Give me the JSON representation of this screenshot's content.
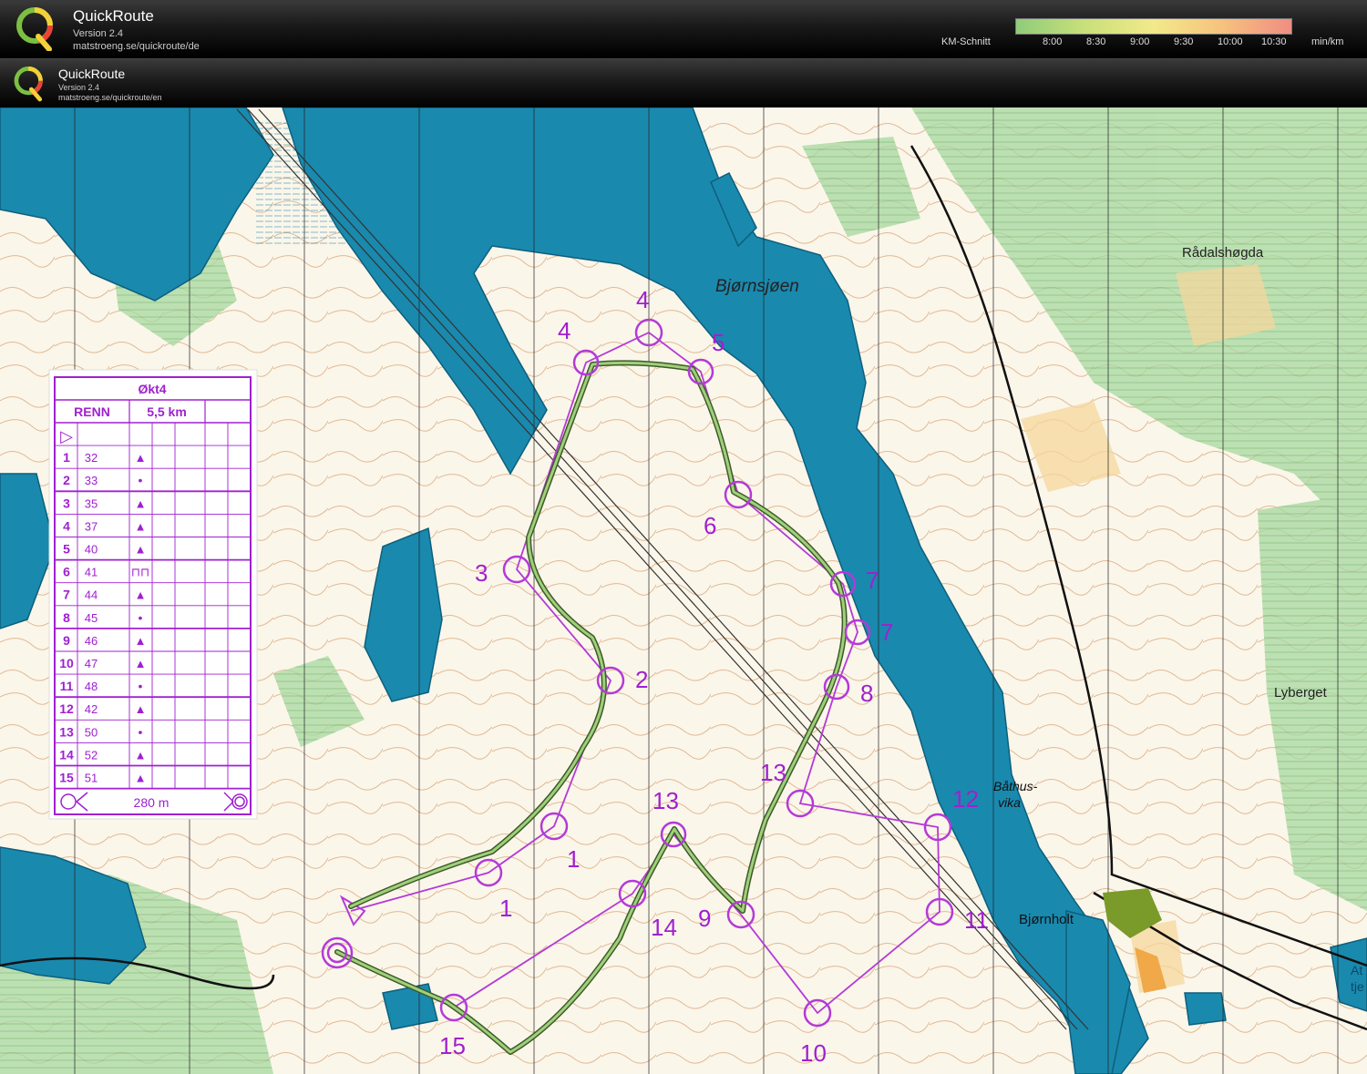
{
  "header_top": {
    "title": "QuickRoute",
    "version": "Version 2.4",
    "url": "matstroeng.se/quickroute/de",
    "pace_label": "KM-Schnitt",
    "pace_ticks": [
      "8:00",
      "8:30",
      "9:00",
      "9:30",
      "10:00",
      "10:30"
    ],
    "pace_unit": "min/km",
    "pace_gradient": [
      "#8fcc7a",
      "#c8e07a",
      "#f3e98a",
      "#f6c27e",
      "#f08d83"
    ]
  },
  "header_second": {
    "title": "QuickRoute",
    "version": "Version 2.4",
    "url": "matstroeng.se/quickroute/en"
  },
  "map": {
    "place_names": [
      "Bjørnsjøen",
      "Rådalshøgda",
      "Lyberget",
      "Båthus-",
      "vika",
      "Bjørnholt",
      "At",
      "tje"
    ],
    "control_labels": [
      "4",
      "4",
      "5",
      "6",
      "3",
      "7",
      "7",
      "2",
      "8",
      "13",
      "12",
      "13",
      "1",
      "1",
      "14",
      "9",
      "11",
      "15",
      "10"
    ],
    "colors": {
      "water": "#1a89ae",
      "open_land": "#fdf3d6",
      "forest": "#ffffff",
      "green": "#7cc07c",
      "contour": "#b8743d",
      "course": "#b43ad8",
      "route": "#5a7a3a"
    }
  },
  "control_card": {
    "title": "Økt4",
    "class_name": "RENN",
    "distance": "5,5 km",
    "start_symbol": "▷",
    "rows": [
      {
        "num": "1",
        "code": "32",
        "symbol": "▲"
      },
      {
        "num": "2",
        "code": "33",
        "symbol": "•"
      },
      {
        "num": "3",
        "code": "35",
        "symbol": "▲"
      },
      {
        "num": "4",
        "code": "37",
        "symbol": "▲"
      },
      {
        "num": "5",
        "code": "40",
        "symbol": "▲"
      },
      {
        "num": "6",
        "code": "41",
        "symbol": "⊓⊓"
      },
      {
        "num": "7",
        "code": "44",
        "symbol": "▲"
      },
      {
        "num": "8",
        "code": "45",
        "symbol": "•"
      },
      {
        "num": "9",
        "code": "46",
        "symbol": "▲"
      },
      {
        "num": "10",
        "code": "47",
        "symbol": "▲"
      },
      {
        "num": "11",
        "code": "48",
        "symbol": "•"
      },
      {
        "num": "12",
        "code": "42",
        "symbol": "▲"
      },
      {
        "num": "13",
        "code": "50",
        "symbol": "•"
      },
      {
        "num": "14",
        "code": "52",
        "symbol": "▲"
      },
      {
        "num": "15",
        "code": "51",
        "symbol": "▲"
      }
    ],
    "finish_distance": "280 m"
  }
}
